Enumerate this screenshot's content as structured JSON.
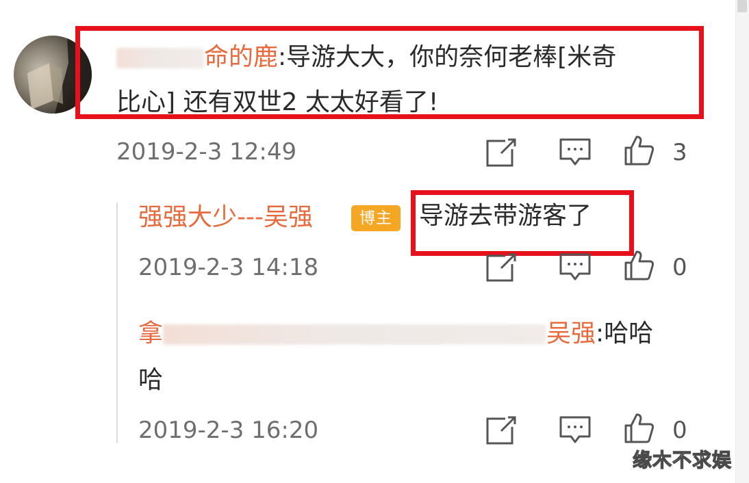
{
  "comment": {
    "username": "拿      命的鹿",
    "username_visible": "命的鹿",
    "separator": ":",
    "text_line1": "导游大大，你的奈何老棒[米奇",
    "text_line2": "比心] 还有双世2 太太好看了!",
    "timestamp": "2019-2-3 12:49",
    "like_count": "3"
  },
  "replies": [
    {
      "username": "强强大少---吴强",
      "badge": "博主",
      "text": "导游去带游客了",
      "timestamp": "2019-2-3 14:18",
      "like_count": "0"
    },
    {
      "username_start": "拿",
      "username_end": "吴强",
      "separator": ":",
      "text_line1": "哈哈",
      "text_line2": "哈",
      "timestamp": "2019-2-3 16:20",
      "like_count": "0"
    }
  ],
  "watermark": "缘木不求娱",
  "colors": {
    "username": "#e86a3c",
    "badge": "#f5a623",
    "highlight": "#e8101a",
    "text": "#2a2a2a",
    "meta": "#6e6e6e"
  },
  "icons": [
    "share-icon",
    "comment-icon",
    "like-icon"
  ]
}
